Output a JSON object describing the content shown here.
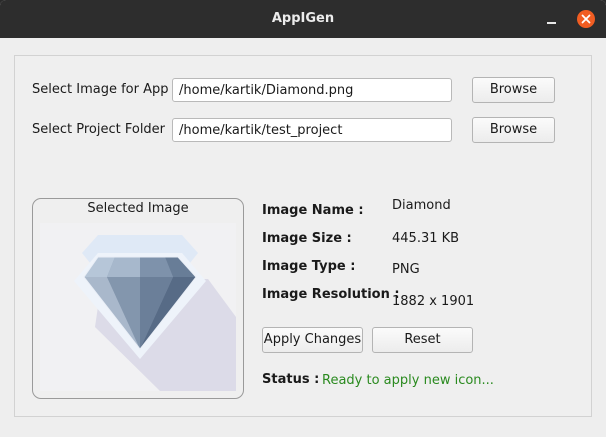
{
  "window": {
    "title": "AppIGen"
  },
  "form": {
    "image_label": "Select Image for App",
    "image_value": "/home/kartik/Diamond.png",
    "folder_label": "Select Project Folder",
    "folder_value": "/home/kartik/test_project",
    "browse_label": "Browse"
  },
  "preview": {
    "title": "Selected Image",
    "icon": "diamond-image"
  },
  "info": {
    "name_key": "Image Name :",
    "name_value": "Diamond",
    "size_key": "Image Size :",
    "size_value": "445.31 KB",
    "type_key": "Image Type :",
    "type_value": "PNG",
    "resolution_key": "Image Resolution :",
    "resolution_value": "1882 x 1901"
  },
  "actions": {
    "apply_label": "Apply Changes",
    "reset_label": "Reset"
  },
  "status": {
    "key": "Status :",
    "value": "Ready to apply new icon...",
    "color": "#2a8a1f"
  },
  "colors": {
    "titlebar": "#2d2d2d",
    "close": "#f15d22",
    "window_bg": "#eeeeee"
  }
}
